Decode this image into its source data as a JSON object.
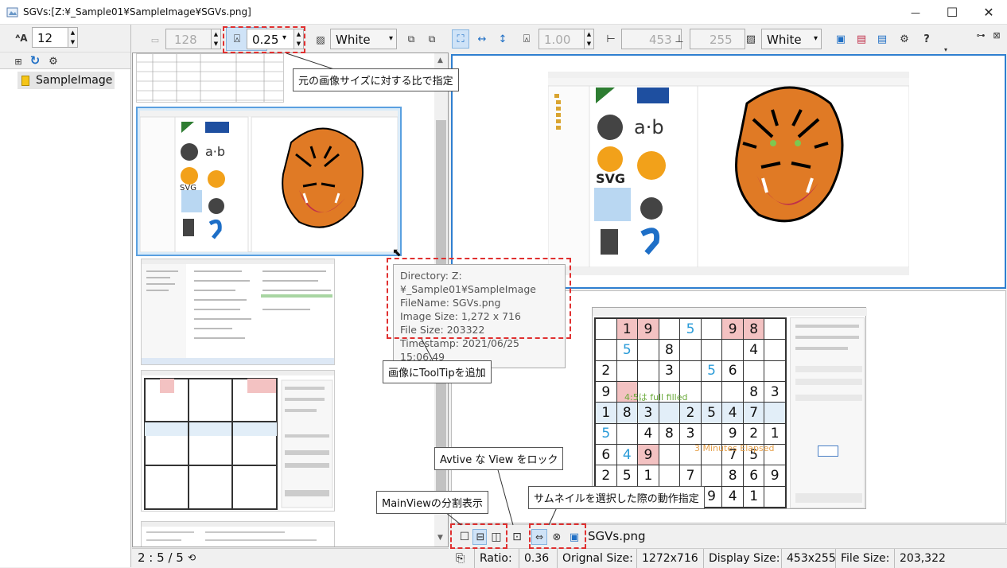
{
  "window": {
    "title": "SGVs:[Z:¥_Sample01¥SampleImage¥SGVs.png]",
    "minimize": "—",
    "maximize": "☐",
    "close": "✕"
  },
  "left_toolbar": {
    "font_size_value": "12",
    "font_icon_label": "ᴬA"
  },
  "tree": {
    "folder_label": "SampleImage"
  },
  "thumb_toolbar": {
    "size_value": "128",
    "ratio_value": "0.25",
    "bg_value": "White"
  },
  "view_toolbar": {
    "ratio_value": "1.00",
    "width_value": "453",
    "height_value": "255",
    "bg_value": "White"
  },
  "status_left": {
    "counter": "2 : 5 / 5"
  },
  "view_footer": {
    "file_name": "SGVs.png"
  },
  "statusbar": {
    "ratio_label": "Ratio:",
    "ratio_value": "0.36",
    "orig_label": "Orignal Size:",
    "orig_value": "1272x716",
    "disp_label": "Display Size:",
    "disp_value": "453x255",
    "file_label": "File Size:",
    "file_value": "203,322"
  },
  "tooltip": {
    "line1": "Directory: Z:¥_Sample01¥SampleImage",
    "line2": "FileName: SGVs.png",
    "line3": "Image Size: 1,272 x 716",
    "line4": "File Size: 203322",
    "line5": "Timestamp: 2021/06/25 15:06:49"
  },
  "callouts": {
    "ratio": "元の画像サイズに対する比で指定",
    "tooltip": "画像にToolTipを追加",
    "lock": "Avtive な View をロック",
    "split": "MainViewの分割表示",
    "thumb_action": "サムネイルを選択した際の動作指定"
  },
  "sudoku": {
    "cells": [
      "",
      "1",
      "9",
      "",
      "5",
      "",
      "9",
      "8",
      "",
      "",
      "5",
      "",
      "8",
      "",
      "",
      "",
      "4",
      "",
      "2",
      "",
      "",
      "3",
      "",
      "5",
      "6",
      "",
      "",
      "9",
      "",
      "",
      "",
      "",
      "",
      "",
      "8",
      "3",
      "1",
      "8",
      "3",
      "",
      "2",
      "5",
      "4",
      "7",
      "",
      "5",
      "",
      "4",
      "8",
      "3",
      "",
      "9",
      "2",
      "1",
      "6",
      "4",
      "9",
      "",
      "",
      "",
      "7",
      "5",
      "",
      "2",
      "5",
      "1",
      "",
      "7",
      "",
      "8",
      "6",
      "9",
      "",
      "3",
      "",
      "5",
      "6",
      "9",
      "4",
      "1",
      ""
    ],
    "message_full": "4:5は full filled",
    "message_time": "3 Minutes Elapsed"
  },
  "colors": {
    "accent_blue": "#2f7fd0",
    "callout_red": "#e03030"
  }
}
